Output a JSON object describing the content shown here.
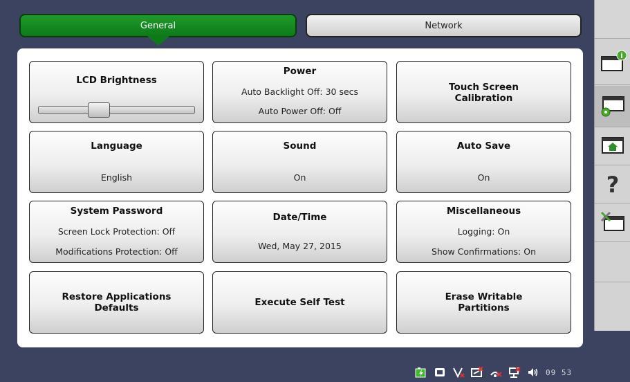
{
  "tabs": {
    "general": "General",
    "network": "Network"
  },
  "tiles": {
    "lcd": {
      "title": "LCD Brightness",
      "brightness_level": 0.37
    },
    "power": {
      "title": "Power",
      "line1": "Auto Backlight Off: 30 secs",
      "line2": "Auto Power Off: Off"
    },
    "touch": {
      "title_line1": "Touch Screen",
      "title_line2": "Calibration"
    },
    "language": {
      "title": "Language",
      "value": "English"
    },
    "sound": {
      "title": "Sound",
      "value": "On"
    },
    "autosave": {
      "title": "Auto Save",
      "value": "On"
    },
    "password": {
      "title": "System Password",
      "line1": "Screen Lock Protection: Off",
      "line2": "Modifications Protection: Off"
    },
    "datetime": {
      "title": "Date/Time",
      "value": "Wed, May 27, 2015"
    },
    "misc": {
      "title": "Miscellaneous",
      "line1": "Logging: On",
      "line2": "Show Confirmations: On"
    },
    "restore": {
      "title_line1": "Restore Applications",
      "title_line2": "Defaults"
    },
    "selftest": {
      "title": "Execute Self Test"
    },
    "erase": {
      "title_line1": "Erase Writable",
      "title_line2": "Partitions"
    }
  },
  "sidebar": {
    "items": [
      {
        "icon": "info-window-icon"
      },
      {
        "icon": "settings-window-icon",
        "active": true
      },
      {
        "icon": "home-folder-icon"
      },
      {
        "icon": "help-icon",
        "glyph": "?"
      },
      {
        "icon": "tools-window-icon"
      }
    ]
  },
  "statusbar": {
    "icons": [
      "battery-charging-icon",
      "storage-icon",
      "v-connection-icon",
      "network-disconnected-icon",
      "wifi-disconnected-icon",
      "lan-disconnected-icon",
      "speaker-icon"
    ],
    "clock": "09 53"
  },
  "colors": {
    "background": "#3c4360",
    "active_tab": "#0d7a19",
    "panel": "#ffffff",
    "sidebar": "#d3d3d3"
  }
}
